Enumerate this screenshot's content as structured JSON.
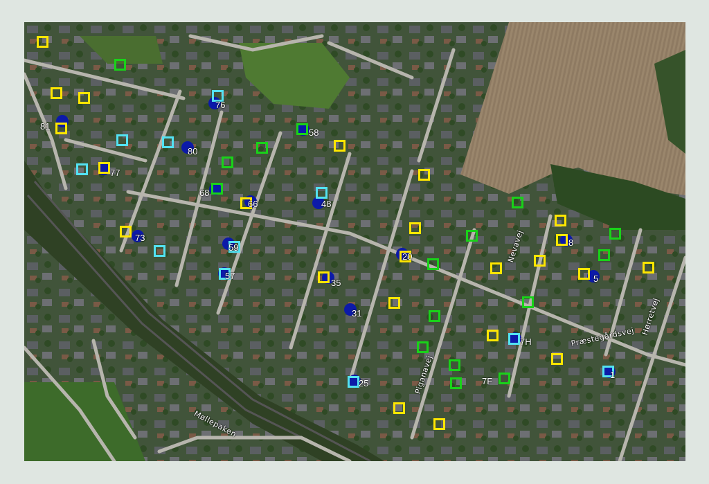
{
  "map": {
    "street_labels": [
      {
        "id": "nevavej",
        "text": "Nevavej"
      },
      {
        "id": "horretvej",
        "text": "Hørretvej"
      },
      {
        "id": "praestegardsvej",
        "text": "Præstegårdsvej"
      },
      {
        "id": "piganavej",
        "text": "Piganavej"
      },
      {
        "id": "mollepaken",
        "text": "Møllepaken"
      }
    ],
    "numbered_points": [
      {
        "id": "p76",
        "text": "76"
      },
      {
        "id": "p81",
        "text": "81"
      },
      {
        "id": "p58",
        "text": "58"
      },
      {
        "id": "p80",
        "text": "80"
      },
      {
        "id": "p77",
        "text": "77"
      },
      {
        "id": "p68",
        "text": "68"
      },
      {
        "id": "p66",
        "text": "66"
      },
      {
        "id": "p48",
        "text": "48"
      },
      {
        "id": "p73",
        "text": "73"
      },
      {
        "id": "p59",
        "text": "59"
      },
      {
        "id": "p20",
        "text": "20"
      },
      {
        "id": "p57",
        "text": "57"
      },
      {
        "id": "p35",
        "text": "35"
      },
      {
        "id": "p31",
        "text": "31"
      },
      {
        "id": "p8",
        "text": "8"
      },
      {
        "id": "p5",
        "text": "5"
      },
      {
        "id": "p7h",
        "text": "7H"
      },
      {
        "id": "p7f",
        "text": "7F"
      },
      {
        "id": "p25",
        "text": "25"
      },
      {
        "id": "p1",
        "text": "1"
      }
    ],
    "marker_colors": {
      "yellow": "#ffe600",
      "green": "#19d219",
      "cyan": "#53e2f2",
      "blue_dot": "#0c1aa8"
    }
  }
}
